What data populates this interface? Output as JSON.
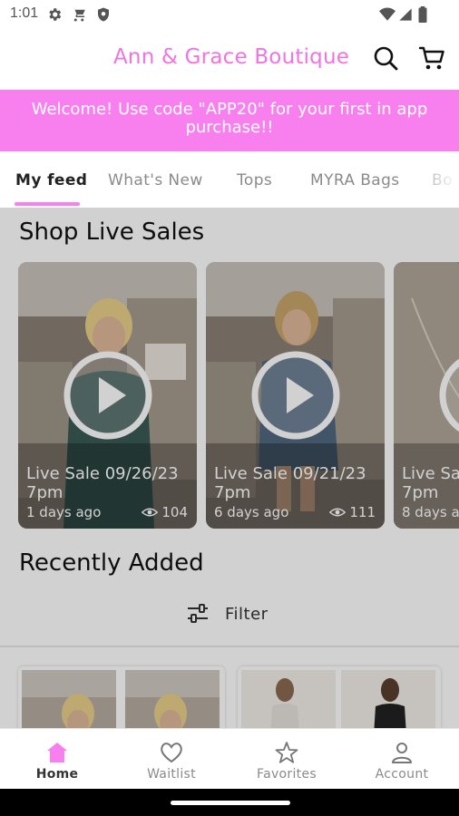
{
  "status_bar": {
    "time": "1:01",
    "icons": [
      "gear-icon",
      "shopping-cart-icon",
      "shield-icon",
      "wifi-icon",
      "signal-icon",
      "battery-icon"
    ]
  },
  "header": {
    "title": "Ann & Grace Boutique",
    "icons": [
      "search-icon",
      "cart-icon"
    ]
  },
  "promo": {
    "text": "Welcome! Use code \"APP20\" for your first in app purchase!!"
  },
  "tabs": [
    {
      "label": "My feed",
      "active": true
    },
    {
      "label": "What's New",
      "active": false
    },
    {
      "label": "Tops",
      "active": false
    },
    {
      "label": "MYRA Bags",
      "active": false
    },
    {
      "label": "Bo",
      "active": false
    }
  ],
  "live_sales": {
    "title": "Shop Live Sales",
    "cards": [
      {
        "title": "Live Sale 09/26/23 7pm",
        "time_ago": "1 days ago",
        "views": "104"
      },
      {
        "title": "Live Sale 09/21/23 7pm",
        "time_ago": "6 days ago",
        "views": "111"
      },
      {
        "title": "Live Sa 7pm",
        "time_ago": "8 days a",
        "views": ""
      }
    ]
  },
  "recently_added": {
    "title": "Recently Added",
    "filter_label": "Filter"
  },
  "bottom_nav": [
    {
      "label": "Home",
      "icon": "home-icon",
      "active": true
    },
    {
      "label": "Waitlist",
      "icon": "heart-icon",
      "active": false
    },
    {
      "label": "Favorites",
      "icon": "star-icon",
      "active": false
    },
    {
      "label": "Account",
      "icon": "account-icon",
      "active": false
    }
  ],
  "colors": {
    "brand_pink": "#f880ee",
    "title_pink": "#ef74e2"
  }
}
